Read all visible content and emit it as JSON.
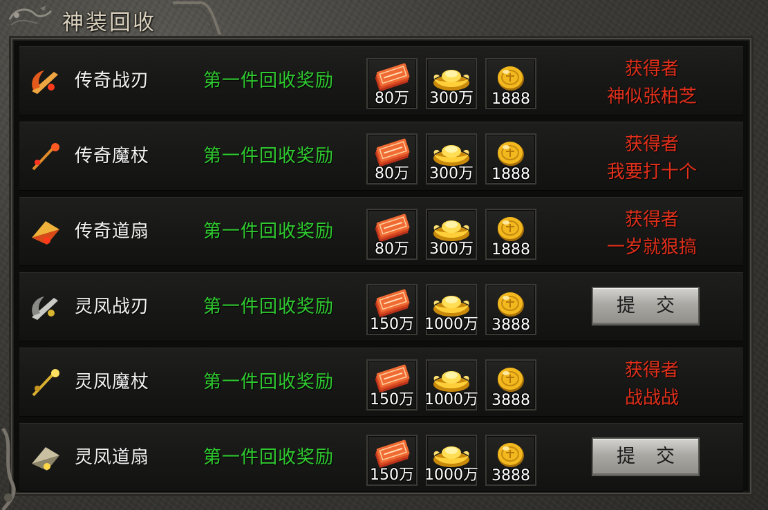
{
  "window": {
    "title": "神装回收"
  },
  "colors": {
    "item_name": "#f2f2f2",
    "reward_label": "#2fc92f",
    "winner_text": "#e2301b",
    "button_face": "#b4b3ae"
  },
  "rows": [
    {
      "name": "传奇战刃",
      "icon": "legend-blade-icon",
      "reward_label": "第一件回收奖励",
      "rewards": [
        "80万",
        "300万",
        "1888"
      ],
      "status": "claimed",
      "winner_label": "获得者",
      "winner_name": "神似张柏芝"
    },
    {
      "name": "传奇魔杖",
      "icon": "legend-staff-icon",
      "reward_label": "第一件回收奖励",
      "rewards": [
        "80万",
        "300万",
        "1888"
      ],
      "status": "claimed",
      "winner_label": "获得者",
      "winner_name": "我要打十个"
    },
    {
      "name": "传奇道扇",
      "icon": "legend-fan-icon",
      "reward_label": "第一件回收奖励",
      "rewards": [
        "80万",
        "300万",
        "1888"
      ],
      "status": "claimed",
      "winner_label": "获得者",
      "winner_name": "一岁就狠搞"
    },
    {
      "name": "灵凤战刃",
      "icon": "phoenix-blade-icon",
      "reward_label": "第一件回收奖励",
      "rewards": [
        "150万",
        "1000万",
        "3888"
      ],
      "status": "open",
      "button_label": "提交"
    },
    {
      "name": "灵凤魔杖",
      "icon": "phoenix-staff-icon",
      "reward_label": "第一件回收奖励",
      "rewards": [
        "150万",
        "1000万",
        "3888"
      ],
      "status": "claimed",
      "winner_label": "获得者",
      "winner_name": "战战战"
    },
    {
      "name": "灵凤道扇",
      "icon": "phoenix-fan-icon",
      "reward_label": "第一件回收奖励",
      "rewards": [
        "150万",
        "1000万",
        "3888"
      ],
      "status": "open",
      "button_label": "提交"
    }
  ],
  "reward_icons": [
    "coupon-bundle-icon",
    "gold-ingot-icon",
    "gold-coin-icon"
  ]
}
